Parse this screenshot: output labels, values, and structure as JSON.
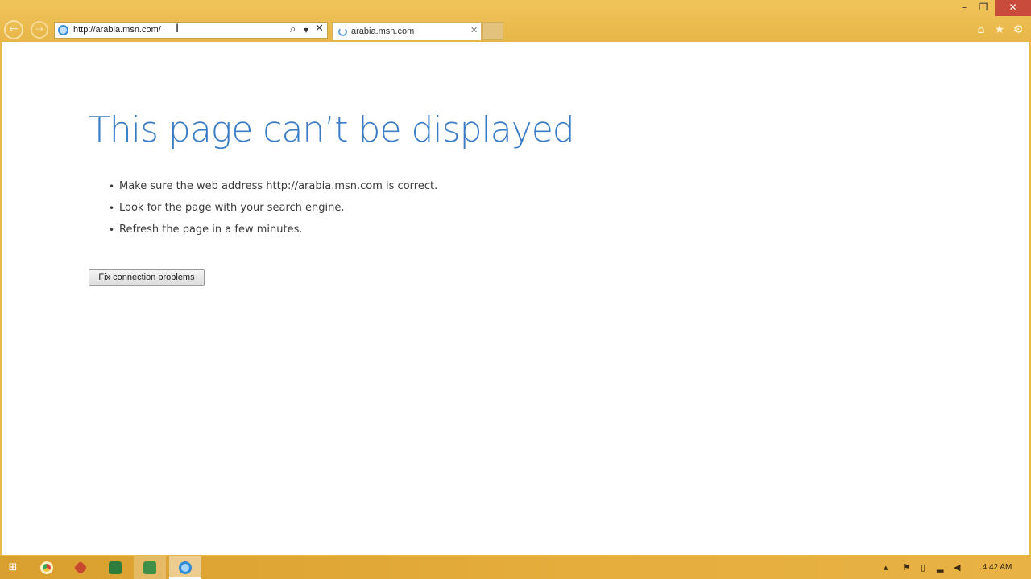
{
  "browser": {
    "address_value": "http://arabia.msn.com/",
    "tab_title": "arabia.msn.com",
    "icons": {
      "back": "back-arrow-icon",
      "forward": "forward-arrow-icon",
      "search": "search-icon",
      "stop": "close-icon",
      "home": "home-icon",
      "favorites": "star-icon",
      "tools": "gear-icon"
    }
  },
  "page": {
    "title": "This page can’t be displayed",
    "suggestions": [
      "Make sure the web address http://arabia.msn.com is correct.",
      "Look for the page with your search engine.",
      "Refresh the page in a few minutes."
    ],
    "fix_button_label": "Fix connection problems",
    "title_color": "#3a7cc6"
  },
  "taskbar": {
    "clock": "4:42 AM",
    "apps": [
      "chrome",
      "tool",
      "excel",
      "excel",
      "internet-explorer"
    ],
    "accent_color": "#e5ad3c"
  }
}
